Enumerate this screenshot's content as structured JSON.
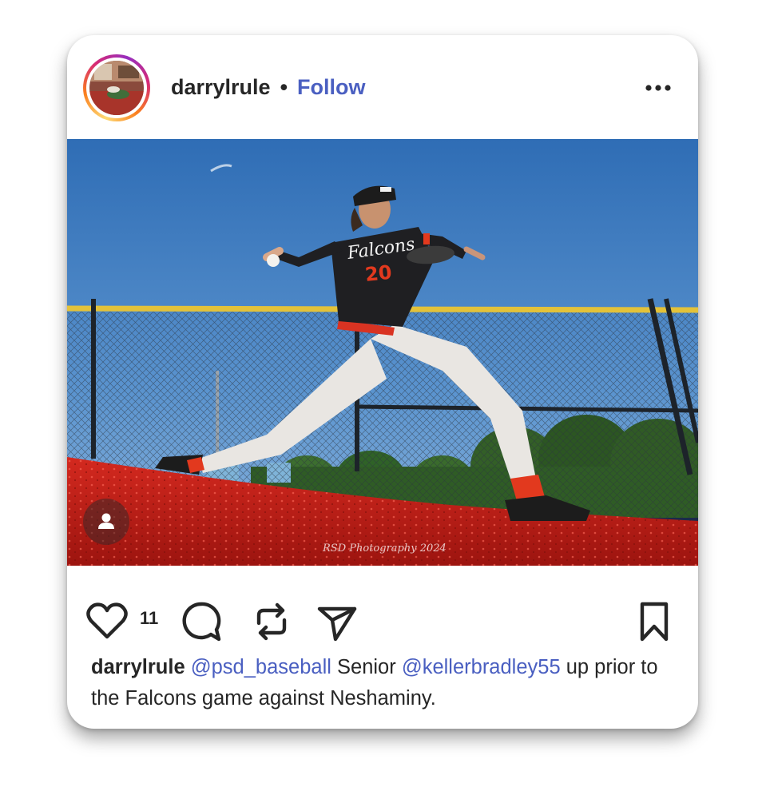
{
  "post": {
    "username": "darrylrule",
    "separator": "•",
    "follow_label": "Follow",
    "more_icon": "more-horizontal-icon",
    "photo": {
      "subject": "baseball-pitcher",
      "jersey_text": "Falcons",
      "jersey_number": "20",
      "watermark": "RSD Photography 2024"
    },
    "tag_icon": "user-tag-icon",
    "likes": "11",
    "icons": {
      "like": "heart-icon",
      "comment": "comment-bubble-icon",
      "repost": "repost-icon",
      "share": "send-icon",
      "save": "bookmark-icon"
    },
    "caption": {
      "username": "darrylrule",
      "mention1": "@psd_baseball",
      "text1": "Senior",
      "mention2": "@kellerbradley55",
      "text2": "up prior to the Falcons game against Neshaminy."
    },
    "colors": {
      "link": "#4a5fc1",
      "text": "#262626",
      "turf": "#c8201a",
      "sky": "#3d7ec4"
    }
  }
}
